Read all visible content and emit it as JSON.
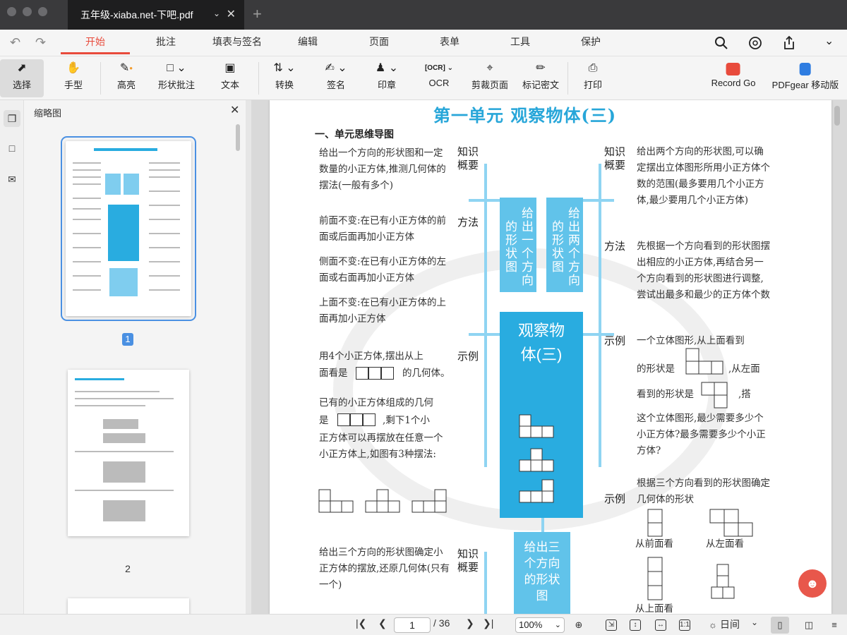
{
  "window": {
    "tab_title": "五年级-xiaba.net-下吧.pdf"
  },
  "menu": {
    "items": [
      "开始",
      "批注",
      "填表与签名",
      "编辑",
      "页面",
      "表单",
      "工具",
      "保护"
    ],
    "active": "开始"
  },
  "toolbar": {
    "select": "选择",
    "hand": "手型",
    "highlight": "高亮",
    "shape_annot": "形状批注",
    "text": "文本",
    "convert": "转换",
    "sign": "签名",
    "stamp": "印章",
    "ocr": "OCR",
    "crop": "剪裁页面",
    "redact": "标记密文",
    "print": "打印",
    "record_go": "Record Go",
    "pdfgear_mobile": "PDFgear 移动版"
  },
  "thumbnails": {
    "title": "缩略图",
    "pages": [
      "1",
      "2"
    ]
  },
  "document": {
    "title": "第一单元   观察物体(三)",
    "section": "一、单元思维导图",
    "left": {
      "label_knowledge": "知识概要",
      "knowledge_text": "给出一个方向的形状图和一定数量的小正方体,推测几何体的摆法(一般有多个)",
      "label_method": "方法",
      "method_front": "前面不变:在已有小正方体的前面或后面再加小正方体",
      "method_side": "侧面不变:在已有小正方体的左面或右面再加小正方体",
      "method_top": "上面不变:在已有小正方体的上面再加小正方体",
      "label_example": "示例",
      "example_1a": "用4个小正方体,摆出从上",
      "example_1b": "面看是",
      "example_1c": "的几何体。",
      "example_2a": "已有的小正方体组成的几何",
      "example_2b": "是",
      "example_2c": ",剩下1个小",
      "example_2d": "正方体可以再摆放在任意一个小正方体上,如图有3种摆法:",
      "label_knowledge2": "知识概要",
      "knowledge2_text": "给出三个方向的形状图确定小正方体的摆放,还原几何体(只有一个)"
    },
    "center": {
      "box_one": "给出一个方向的形状图",
      "box_two": "给出两个方向的形状图",
      "box_main": "观察物体(三)",
      "box_three": "给出三个方向的形状图"
    },
    "right": {
      "label_knowledge": "知识概要",
      "knowledge_text": "给出两个方向的形状图,可以确定摆出立体图形所用小正方体个数的范围(最多要用几个小正方体,最少要用几个小正方体)",
      "label_method": "方法",
      "method_text": "先根据一个方向看到的形状图摆出相应的小正方体,再结合另一个方向看到的形状图进行调整,尝试出最多和最少的正方体个数",
      "label_example": "示例",
      "example_a": "一个立体图形,从上面看到",
      "example_b": "的形状是",
      "example_c": ",从左面",
      "example_d": "看到的形状是",
      "example_e": ",搭",
      "example_f": "这个立体图形,最少需要多少个小正方体?最多需要多少个小正方体?",
      "label_example2": "示例",
      "example2_text": "根据三个方向看到的形状图确定几何体的形状",
      "view_front": "从前面看",
      "view_left": "从左面看",
      "view_top": "从上面看"
    }
  },
  "statusbar": {
    "current_page": "1",
    "total_pages": "/ 36",
    "zoom": "100%",
    "theme": "日间"
  },
  "colors": {
    "accent": "#e84b3c",
    "doc_blue": "#29ace0",
    "selection_blue": "#4a90e2"
  },
  "icons": [
    "undo-icon",
    "redo-icon",
    "search-icon",
    "support-icon",
    "share-icon",
    "cursor-icon",
    "hand-icon",
    "highlighter-icon",
    "rectangle-icon",
    "text-box-icon",
    "convert-icon",
    "signature-icon",
    "stamp-icon",
    "ocr-icon",
    "crop-icon",
    "redact-icon",
    "printer-icon",
    "record-icon",
    "mobile-icon",
    "pages-icon",
    "bookmark-icon",
    "comment-icon",
    "close-icon",
    "first-page-icon",
    "prev-page-icon",
    "next-page-icon",
    "last-page-icon",
    "zoom-in-icon",
    "fit-page-icon",
    "fit-height-icon",
    "fit-width-icon",
    "actual-size-icon",
    "sun-icon",
    "single-page-icon",
    "two-page-icon",
    "scroll-icon"
  ]
}
